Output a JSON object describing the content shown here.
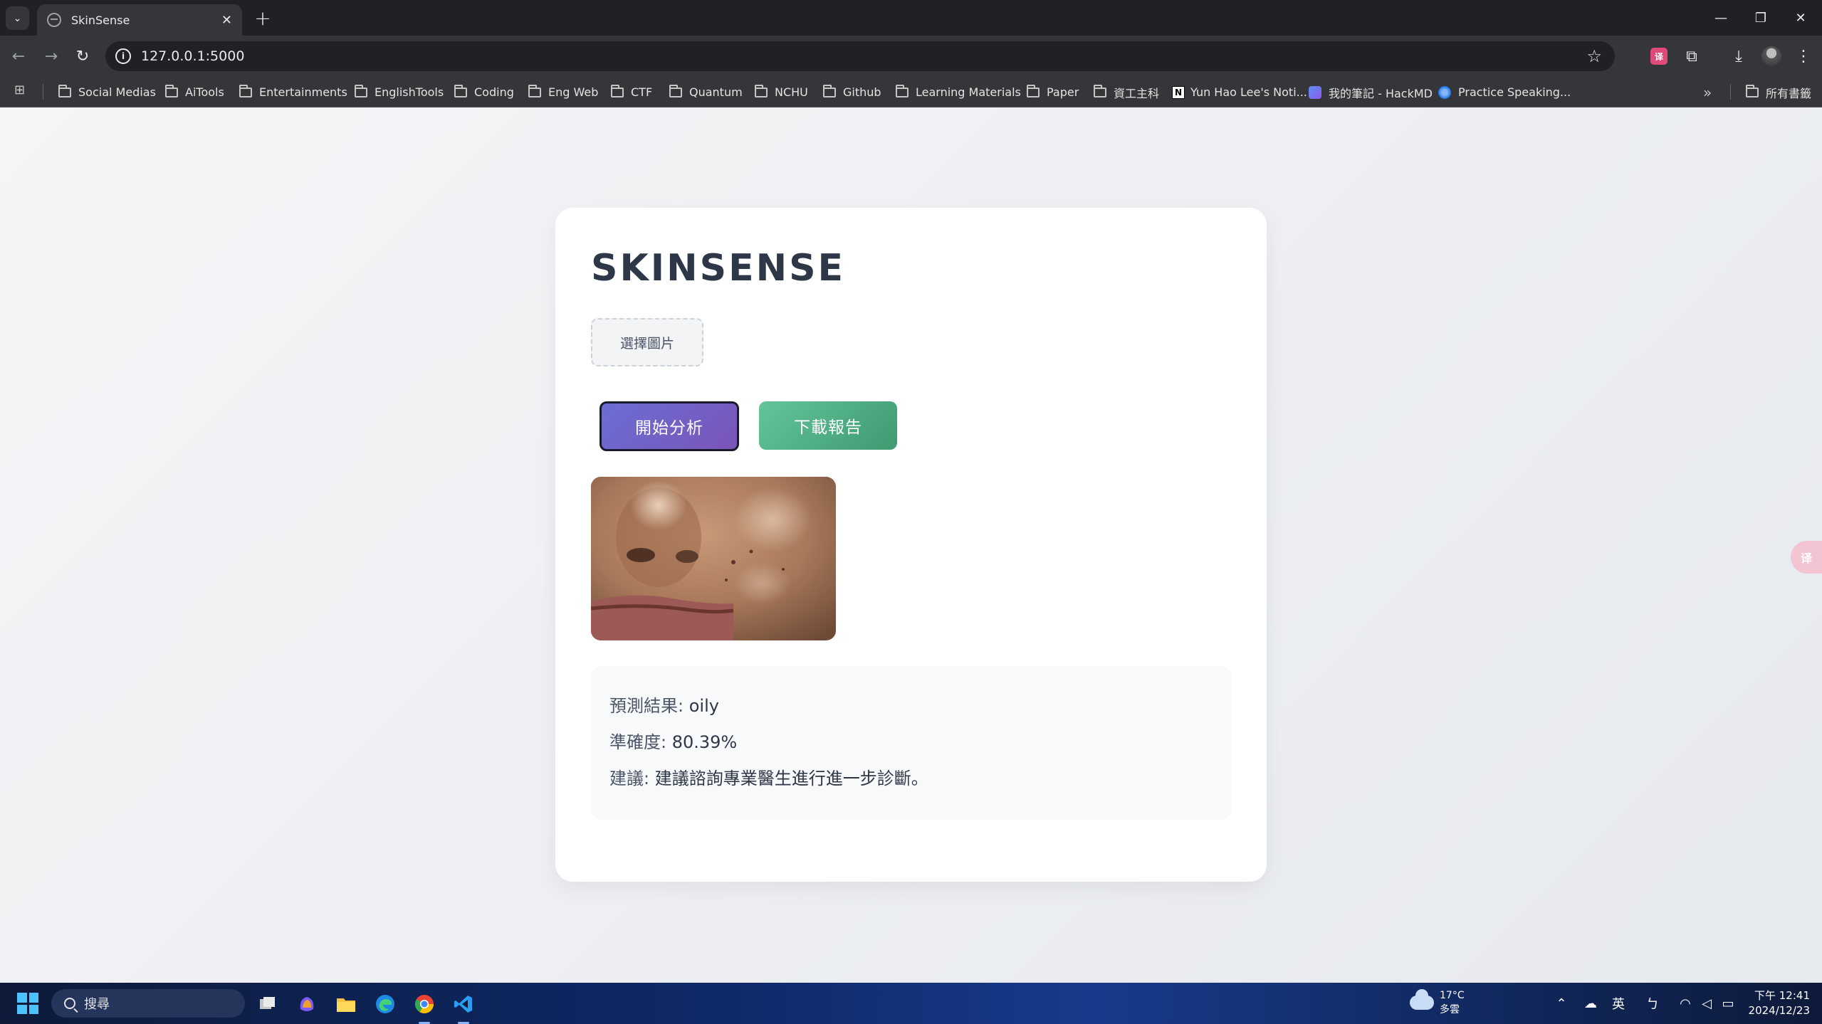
{
  "browser": {
    "tab_title": "SkinSense",
    "url": "127.0.0.1:5000",
    "bookmarks": [
      {
        "label": "Social Medias",
        "icon": "folder-icon"
      },
      {
        "label": "AiTools",
        "icon": "folder-icon"
      },
      {
        "label": "Entertainments",
        "icon": "folder-icon"
      },
      {
        "label": "EnglishTools",
        "icon": "folder-icon"
      },
      {
        "label": "Coding",
        "icon": "folder-icon"
      },
      {
        "label": "Eng Web",
        "icon": "folder-icon"
      },
      {
        "label": "CTF",
        "icon": "folder-icon"
      },
      {
        "label": "Quantum",
        "icon": "folder-icon"
      },
      {
        "label": "NCHU",
        "icon": "folder-icon"
      },
      {
        "label": "Github",
        "icon": "folder-icon"
      },
      {
        "label": "Learning Materials",
        "icon": "folder-icon"
      },
      {
        "label": "Paper",
        "icon": "folder-icon"
      },
      {
        "label": "資工主科",
        "icon": "folder-icon"
      },
      {
        "label": "Yun Hao Lee's Noti...",
        "icon": "notion-icon"
      },
      {
        "label": "我的筆記 - HackMD",
        "icon": "hackmd-icon"
      },
      {
        "label": "Practice Speaking...",
        "icon": "practice-speaking-icon"
      }
    ],
    "all_bookmarks_label": "所有書籤"
  },
  "app": {
    "title": "SKINSENSE",
    "choose_image_label": "選擇圖片",
    "analyze_label": "開始分析",
    "download_label": "下載報告",
    "result": {
      "prediction_label": "預測結果: ",
      "prediction_value": "oily",
      "accuracy_label": "準確度: ",
      "accuracy_value": "80.39%",
      "advice_label": "建議: ",
      "advice_value": "建議諮詢專業醫生進行進一步診斷。"
    },
    "colors": {
      "analyze_button": "#6a6ed4",
      "download_button": "#52b386",
      "title": "#2d3748"
    }
  },
  "taskbar": {
    "search_placeholder": "搜尋",
    "weather_temp": "17°C",
    "weather_desc": "多雲",
    "ime_label": "英",
    "time": "下午 12:41",
    "date": "2024/12/23"
  }
}
